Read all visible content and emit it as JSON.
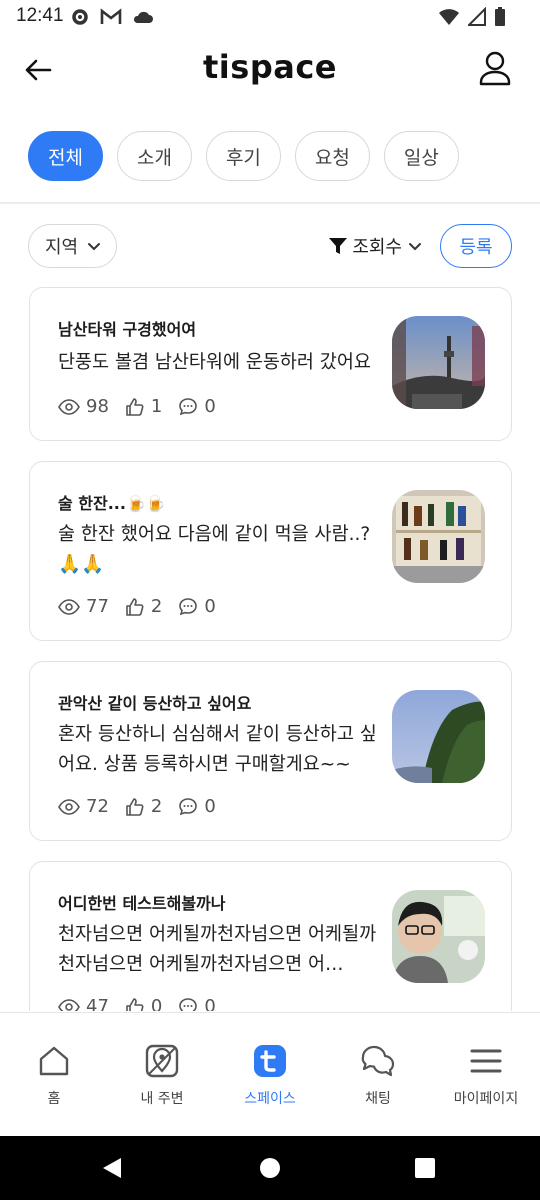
{
  "status_bar": {
    "time": "12:41",
    "icons": [
      "gear-icon",
      "gmail-icon",
      "cloud-icon",
      "wifi-icon",
      "signal-icon",
      "battery-icon"
    ]
  },
  "app_bar": {
    "title": "tispace",
    "back_icon": "arrow-left-icon",
    "profile_icon": "person-icon"
  },
  "categories": [
    {
      "label": "전체",
      "active": true
    },
    {
      "label": "소개",
      "active": false
    },
    {
      "label": "후기",
      "active": false
    },
    {
      "label": "요청",
      "active": false
    },
    {
      "label": "일상",
      "active": false
    }
  ],
  "filters": {
    "region_label": "지역",
    "sort_label": "조회수",
    "register_label": "등록"
  },
  "posts": [
    {
      "title": "남산타워 구경했어여",
      "body": "단풍도 볼겸 남산타워에 운동하러 갔어요",
      "views": "98",
      "likes": "1",
      "comments": "0"
    },
    {
      "title": "술 한잔...🍺🍺",
      "body": "술 한잔 했어요 다음에 같이 먹을 사람..? 🙏🙏",
      "views": "77",
      "likes": "2",
      "comments": "0"
    },
    {
      "title": "관악산 같이 등산하고 싶어요",
      "body": "혼자 등산하니 심심해서 같이 등산하고 싶어요. 상품 등록하시면 구매할게요~~",
      "views": "72",
      "likes": "2",
      "comments": "0"
    },
    {
      "title": "어디한번 테스트해볼까나",
      "body": "천자넘으면 어케될까천자넘으면 어케될까천자넘으면 어케될까천자넘으면 어…",
      "views": "47",
      "likes": "0",
      "comments": "0"
    }
  ],
  "bottom_nav": [
    {
      "label": "홈",
      "icon": "home-icon",
      "active": false
    },
    {
      "label": "내 주변",
      "icon": "map-pin-icon",
      "active": false
    },
    {
      "label": "스페이스",
      "icon": "tispace-icon",
      "active": true
    },
    {
      "label": "채팅",
      "icon": "chat-icon",
      "active": false
    },
    {
      "label": "마이페이지",
      "icon": "menu-icon",
      "active": false
    }
  ],
  "colors": {
    "accent": "#2f7bf5",
    "border": "#e2e2e2"
  }
}
